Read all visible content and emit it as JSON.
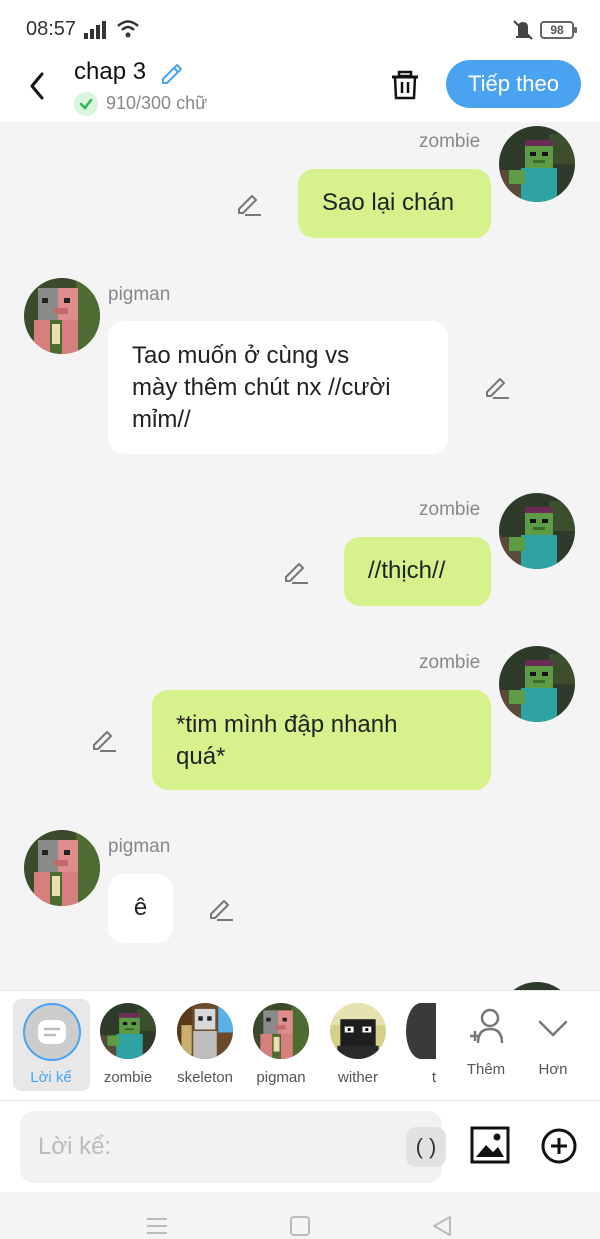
{
  "status": {
    "time": "08:57",
    "battery": "98"
  },
  "header": {
    "title": "chap 3",
    "word_count": "910/300 chữ",
    "next_label": "Tiếp theo"
  },
  "messages": [
    {
      "speaker": "zombie",
      "side": "right",
      "lines": [
        "Sao lại chán"
      ]
    },
    {
      "speaker": "pigman",
      "side": "left",
      "lines": [
        "Tao muốn ở cùng vs",
        "mày thêm chút nx //cười",
        "mỉm//"
      ]
    },
    {
      "speaker": "zombie",
      "side": "right",
      "lines": [
        "//thịch//"
      ]
    },
    {
      "speaker": "zombie",
      "side": "right",
      "lines": [
        "*tim mình đập nhanh",
        "quá*"
      ]
    },
    {
      "speaker": "pigman",
      "side": "left",
      "lines": [
        "ê"
      ]
    }
  ],
  "characters": {
    "narrator": "Lời kể",
    "zombie": "zombie",
    "skeleton": "skeleton",
    "pigman": "pigman",
    "wither": "wither",
    "partial": "t",
    "add_label": "Thêm",
    "more_label": "Hơn"
  },
  "input": {
    "placeholder": "Lời kể:",
    "paren": "( )"
  },
  "icons": [
    "back-arrow-icon",
    "pencil-icon",
    "check-icon",
    "trash-icon",
    "image-icon",
    "plus-circle-icon",
    "add-person-icon",
    "chevron-down-icon",
    "menu-icon",
    "home-square-icon",
    "back-triangle-icon"
  ],
  "colors": {
    "accent": "#4aa3f0",
    "bubble_right": "#d5f28d",
    "bubble_left": "#ffffff",
    "background": "#f4f4f4"
  }
}
